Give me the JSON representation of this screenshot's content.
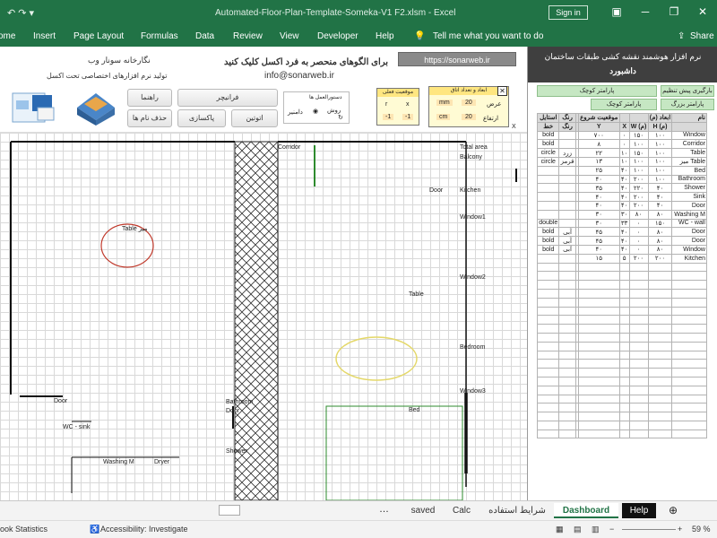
{
  "window": {
    "doc_title": "Automated-Floor-Plan-Template-Someka-V1 F2.xlsm - Excel",
    "signin": "Sign in"
  },
  "ribbon": {
    "tabs": [
      "ome",
      "Insert",
      "Page Layout",
      "Formulas",
      "Data",
      "Review",
      "View",
      "Developer",
      "Help"
    ],
    "tell_me": "Tell me what you want to do",
    "share": "Share"
  },
  "header": {
    "brand_small": "نگارخانه سونار وب",
    "brand_sub": "تولید نرم افزارهای اختصاصی تحت اکسل",
    "promo": "برای الگوهای منحصر به فرد اکسل کلیک کنید",
    "email": "info@sonarweb.ir",
    "url": "https://sonarweb.ir"
  },
  "controls": {
    "btn_help": "راهنما",
    "btn_clear_names": "حذف نام ها",
    "btn_furniture": "فرانیچر",
    "btn_clean": "پاکسازی",
    "btn_optimal": "اتوتین",
    "rotate_title": "دستورالعمل ها",
    "rotate_a": "دامنیر",
    "rotate_b": "روش",
    "activity_title": "موقعیت فعلی",
    "activity_r": "r",
    "activity_x": "x",
    "activity_v1": "-1",
    "activity_v2": "-1",
    "dims_title": "ابعاد و تعداد اتاق",
    "width_label": "عرض",
    "height_label": "ارتفاع",
    "unit": "mm",
    "unit2": "cm",
    "width_value": "20",
    "height_value": "20",
    "x_marker": "X"
  },
  "plan_labels": {
    "corridor": "Corridor",
    "total_area": "Total area",
    "balcony": "Balcony",
    "kitchen": "Kitchen",
    "door_top": "Door",
    "window1": "Window1",
    "window2": "Window2",
    "table_right": "Table",
    "bedroom": "Bedroom",
    "window3": "Window3",
    "bed": "Bed",
    "bathroom": "Bathroom",
    "door_mid": "Door",
    "shower": "Shower",
    "door_left": "Door",
    "wc_sink": "WC - sink",
    "washing": "Washing M",
    "dryer": "Dryer",
    "table_left": "Table میز"
  },
  "right_panel": {
    "title1": "نرم افزار هوشمند نقشه کشی طبقات ساختمان",
    "title2": "داشبورد",
    "btn1": "بارگیری پیش تنظیم",
    "btn2": "پارامتر کوچک",
    "btn3": "پارامتر بزرگ",
    "btn4": "پارامتر کوچک"
  },
  "table": {
    "head1": [
      "نام",
      "ابعاد (م)",
      "",
      "",
      "موقعیت شروع",
      "",
      "رنگ",
      "استایل"
    ],
    "head2": [
      "",
      "H (م)",
      "W (م)",
      "X",
      "Y",
      "",
      "رنگ",
      "خط"
    ],
    "rows": [
      [
        "Window",
        "۱۰۰",
        "۱۵۰",
        "۰",
        "۷۰۰",
        "",
        "",
        "bold"
      ],
      [
        "Corridor",
        "۱۰۰",
        "۱۰۰",
        "۰",
        "۸",
        "",
        "",
        "bold"
      ],
      [
        "Table",
        "۱۰۰",
        "۱۵۰",
        "۱۰",
        "۲۲",
        "",
        "زرد",
        "circle"
      ],
      [
        "میز Table",
        "۱۰۰",
        "۱۰۰",
        "۱۰",
        "۱۳",
        "",
        "قرمز",
        "circle"
      ],
      [
        "Bed",
        "۱۰۰",
        "۱۰۰",
        "۴۰",
        "۲۵",
        "",
        "",
        ""
      ],
      [
        "Bathroom",
        "۱۰۰",
        "۲۰۰",
        "۴۰",
        "۴۰",
        "",
        "",
        ""
      ],
      [
        "Shower",
        "۴۰",
        "۲۲۰",
        "۴۰",
        "۳۵",
        "",
        "",
        ""
      ],
      [
        "Sink",
        "۴۰",
        "۲۰۰",
        "۴۰",
        "۴۰",
        "",
        "",
        ""
      ],
      [
        "Door",
        "۴۰",
        "۲۰۰",
        "۴۰",
        "۴۰",
        "",
        "",
        ""
      ],
      [
        "Washing M",
        "۸۰",
        "۸۰",
        "۳۰",
        "۳۰",
        "",
        "",
        ""
      ],
      [
        "WC - wall",
        "۱۵۰",
        "۰",
        "۳۳",
        "۳۰",
        "",
        "",
        "double"
      ],
      [
        "Door",
        "۸۰",
        "۰",
        "۴۰",
        "۴۵",
        "",
        "آبی",
        "bold"
      ],
      [
        "Door",
        "۸۰",
        "۰",
        "۴۰",
        "۴۵",
        "",
        "آبی",
        "bold"
      ],
      [
        "Window",
        "۸۰",
        "۰",
        "۴۰",
        "۴۰",
        "",
        "آبی",
        "bold"
      ],
      [
        "Kitchen",
        "۲۰۰",
        "۲۰۰",
        "۵",
        "۱۵",
        "",
        "",
        ""
      ]
    ],
    "empty_rows": 20
  },
  "sheet_tabs": [
    "saved",
    "Calc",
    "شرایط استفاده",
    "Dashboard",
    "Help"
  ],
  "status": {
    "left": "ook Statistics",
    "accessibility": "Accessibility: Investigate",
    "zoom": "59 %"
  }
}
